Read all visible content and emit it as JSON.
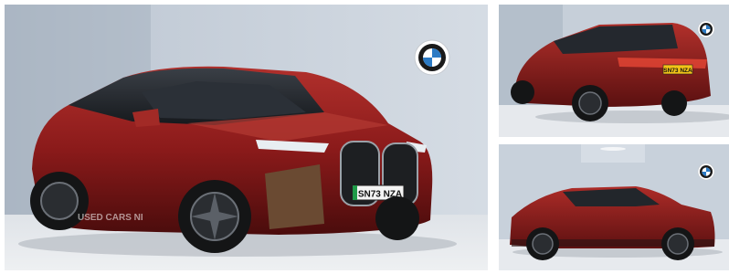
{
  "gallery": {
    "main_photo": {
      "plate": "SN73 NZA",
      "watermark": "USED CARS NI",
      "logo": "bmw-roundel-icon"
    },
    "rear_photo": {
      "plate": "SN73 NZA",
      "logo": "bmw-roundel-icon"
    },
    "side_photo": {
      "logo": "bmw-roundel-icon"
    }
  },
  "colors": {
    "car_paint": "#8e1d1d",
    "backdrop": "#c9d3de",
    "floor": "#e9ebee",
    "plate_yellow": "#f2c318",
    "plate_green": "#1f9a48"
  }
}
